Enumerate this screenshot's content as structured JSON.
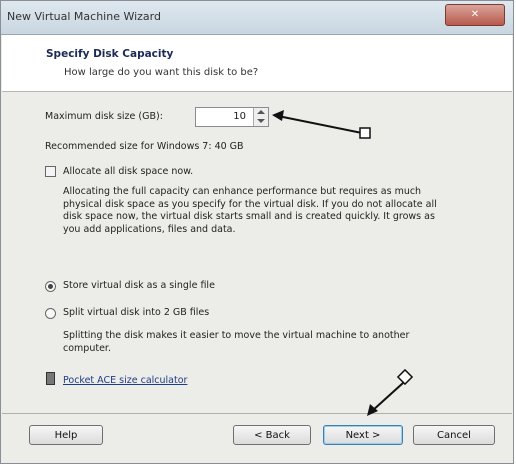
{
  "window": {
    "title": "New Virtual Machine Wizard",
    "close_label": "✕"
  },
  "header": {
    "title": "Specify Disk Capacity",
    "subtitle": "How large do you want this disk to be?"
  },
  "disk": {
    "max_size_label": "Maximum disk size (GB):",
    "max_size_value": "10",
    "recommended": "Recommended size for Windows 7: 40 GB"
  },
  "allocate": {
    "label": "Allocate all disk space now.",
    "checked": false,
    "description_lines": [
      "Allocating the full capacity can enhance performance but requires as much",
      "physical disk space as you specify for the virtual disk. If you do not allocate all",
      "disk space now, the virtual disk starts small and is created quickly. It grows as",
      "you add applications, files and data."
    ]
  },
  "storage": {
    "single_file_label": "Store virtual disk as a single file",
    "split_label": "Split virtual disk into 2 GB files",
    "selected": "single",
    "split_description_lines": [
      "Splitting the disk makes it easier to move the virtual machine to another",
      "computer."
    ]
  },
  "calculator_link": "Pocket ACE size calculator",
  "footer": {
    "help": "Help",
    "back": "< Back",
    "next": "Next >",
    "cancel": "Cancel"
  },
  "icons": {
    "calculator": "calculator-icon",
    "spin_up": "spin-up-icon",
    "spin_down": "spin-down-icon"
  },
  "colors": {
    "header_bg": "#ffffff",
    "dialog_bg": "#ecece8",
    "title_text": "#1b2a55",
    "link": "#1f3c88"
  }
}
